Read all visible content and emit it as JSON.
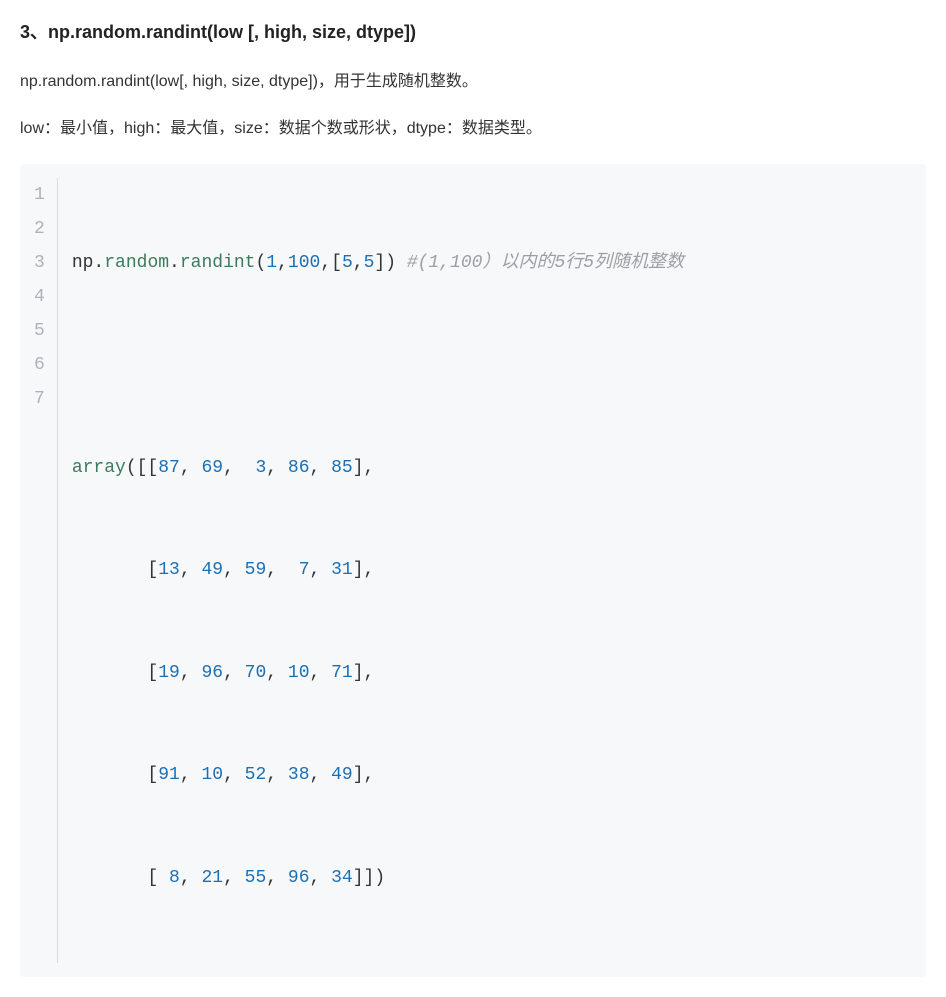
{
  "heading": "3、np.random.randint(low [, high, size, dtype])",
  "para1": "np.random.randint(low[, high, size, dtype])，用于生成随机整数。",
  "para2": "low：最小值，high：最大值，size：数据个数或形状，dtype：数据类型。",
  "code": {
    "line_numbers": [
      "1",
      "2",
      "3",
      "4",
      "5",
      "6",
      "7"
    ],
    "line1": {
      "np": "np",
      "dot1": ".",
      "random": "random",
      "dot2": ".",
      "randint": "randint",
      "lp": "(",
      "a1": "1",
      "c1": ",",
      "a2": "100",
      "c2": ",",
      "lb": "[",
      "a3": "5",
      "c3": ",",
      "a4": "5",
      "rb": "]",
      "rp": ")",
      "sp": " ",
      "comment": "#(1,100）以内的5行5列随机整数"
    },
    "line2": "",
    "line3": {
      "array": "array",
      "open": "([[",
      "v0": "87",
      "c0": ", ",
      "v1": "69",
      "c1": ",  ",
      "v2": "3",
      "c2": ", ",
      "v3": "86",
      "c3": ", ",
      "v4": "85",
      "close": "],"
    },
    "line4": {
      "indent": "       [",
      "v0": "13",
      "c0": ", ",
      "v1": "49",
      "c1": ", ",
      "v2": "59",
      "c2": ",  ",
      "v3": "7",
      "c3": ", ",
      "v4": "31",
      "close": "],"
    },
    "line5": {
      "indent": "       [",
      "v0": "19",
      "c0": ", ",
      "v1": "96",
      "c1": ", ",
      "v2": "70",
      "c2": ", ",
      "v3": "10",
      "c3": ", ",
      "v4": "71",
      "close": "],"
    },
    "line6": {
      "indent": "       [",
      "v0": "91",
      "c0": ", ",
      "v1": "10",
      "c1": ", ",
      "v2": "52",
      "c2": ", ",
      "v3": "38",
      "c3": ", ",
      "v4": "49",
      "close": "],"
    },
    "line7": {
      "indent": "       [ ",
      "v0": "8",
      "c0": ", ",
      "v1": "21",
      "c1": ", ",
      "v2": "55",
      "c2": ", ",
      "v3": "96",
      "c3": ", ",
      "v4": "34",
      "close": "]])"
    }
  }
}
